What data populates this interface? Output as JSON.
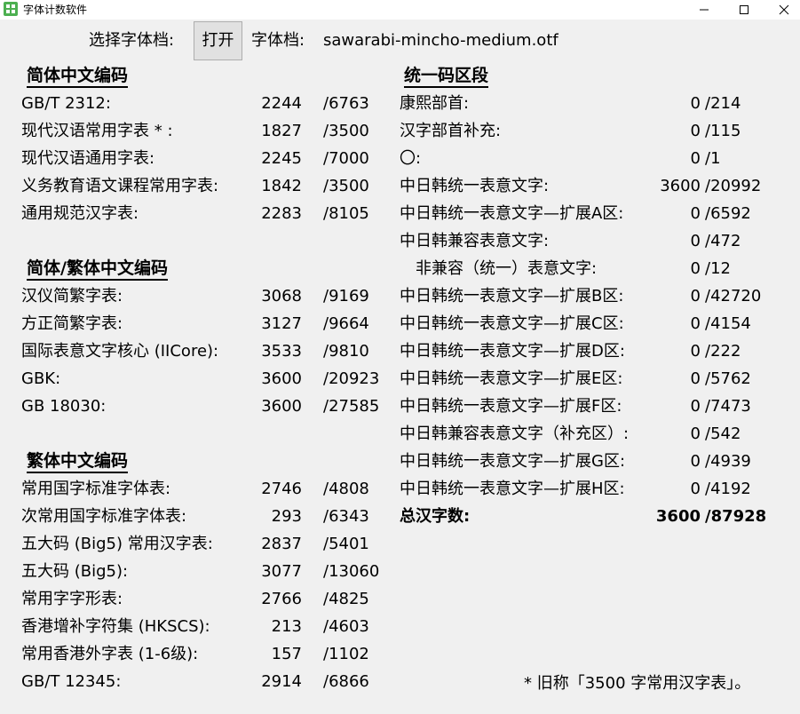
{
  "window": {
    "title": "字体计数软件",
    "icon": "app-grid-icon",
    "accent_color": "#4caf50"
  },
  "toolbar": {
    "select_label": "选择字体档:",
    "open_button": "打开",
    "font_label": "字体档:",
    "font_file": "sawarabi-mincho-medium.otf"
  },
  "left_sections": [
    {
      "title": "简体中文编码",
      "rows": [
        {
          "label": "GB/T 2312:",
          "count": "2244",
          "total": "/6763"
        },
        {
          "label": "现代汉语常用字表 * :",
          "count": "1827",
          "total": "/3500"
        },
        {
          "label": "现代汉语通用字表:",
          "count": "2245",
          "total": "/7000"
        },
        {
          "label": "义务教育语文课程常用字表:",
          "count": "1842",
          "total": "/3500"
        },
        {
          "label": "通用规范汉字表:",
          "count": "2283",
          "total": "/8105"
        }
      ]
    },
    {
      "title": "简体/繁体中文编码",
      "rows": [
        {
          "label": "汉仪简繁字表:",
          "count": "3068",
          "total": "/9169"
        },
        {
          "label": "方正简繁字表:",
          "count": "3127",
          "total": "/9664"
        },
        {
          "label": "国际表意文字核心 (IICore):",
          "count": "3533",
          "total": "/9810"
        },
        {
          "label": "GBK:",
          "count": "3600",
          "total": "/20923"
        },
        {
          "label": "GB 18030:",
          "count": "3600",
          "total": "/27585"
        }
      ]
    },
    {
      "title": "繁体中文编码",
      "rows": [
        {
          "label": "常用国字标准字体表:",
          "count": "2746",
          "total": "/4808"
        },
        {
          "label": "次常用国字标准字体表:",
          "count": "293",
          "total": "/6343"
        },
        {
          "label": "五大码 (Big5) 常用汉字表:",
          "count": "2837",
          "total": "/5401"
        },
        {
          "label": "五大码 (Big5):",
          "count": "3077",
          "total": "/13060"
        },
        {
          "label": "常用字字形表:",
          "count": "2766",
          "total": "/4825"
        },
        {
          "label": "香港增补字符集 (HKSCS):",
          "count": "213",
          "total": "/4603"
        },
        {
          "label": "常用香港外字表 (1-6级):",
          "count": "157",
          "total": "/1102"
        },
        {
          "label": "GB/T 12345:",
          "count": "2914",
          "total": "/6866"
        }
      ]
    }
  ],
  "right_section": {
    "title": "统一码区段",
    "rows": [
      {
        "label": "康熙部首:",
        "count": "0",
        "total": "/214"
      },
      {
        "label": "汉字部首补充:",
        "count": "0",
        "total": "/115"
      },
      {
        "label": "〇:",
        "count": "0",
        "total": "/1"
      },
      {
        "label": "中日韩统一表意文字:",
        "count": "3600",
        "total": "/20992"
      },
      {
        "label": "中日韩统一表意文字—扩展A区:",
        "count": "0",
        "total": "/6592"
      },
      {
        "label": "中日韩兼容表意文字:",
        "count": "0",
        "total": "/472"
      },
      {
        "label": "非兼容（统一）表意文字:",
        "count": "0",
        "total": "/12"
      },
      {
        "label": "中日韩统一表意文字—扩展B区:",
        "count": "0",
        "total": "/42720"
      },
      {
        "label": "中日韩统一表意文字—扩展C区:",
        "count": "0",
        "total": "/4154"
      },
      {
        "label": "中日韩统一表意文字—扩展D区:",
        "count": "0",
        "total": "/222"
      },
      {
        "label": "中日韩统一表意文字—扩展E区:",
        "count": "0",
        "total": "/5762"
      },
      {
        "label": "中日韩统一表意文字—扩展F区:",
        "count": "0",
        "total": "/7473"
      },
      {
        "label": "中日韩兼容表意文字（补充区）:",
        "count": "0",
        "total": "/542"
      },
      {
        "label": "中日韩统一表意文字—扩展G区:",
        "count": "0",
        "total": "/4939"
      },
      {
        "label": "中日韩统一表意文字—扩展H区:",
        "count": "0",
        "total": "/4192"
      }
    ],
    "summary": {
      "label": "总汉字数:",
      "count": "3600",
      "total": "/87928"
    }
  },
  "footnote": "* 旧称「3500 字常用汉字表」。"
}
